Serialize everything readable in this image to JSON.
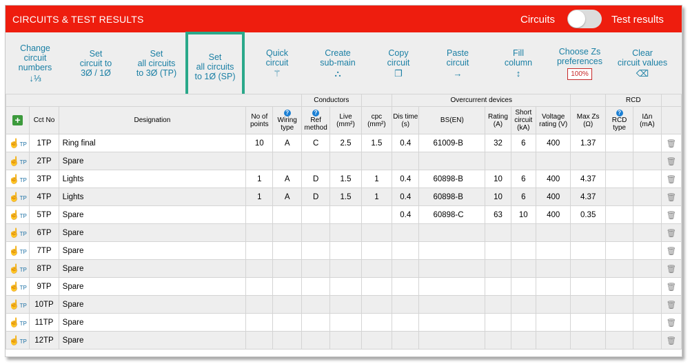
{
  "header": {
    "title": "CIRCUITS & TEST RESULTS",
    "toggle_left_label": "Circuits",
    "toggle_right_label": "Test results",
    "toggle_state": "off",
    "accent_color": "#ee1d0e"
  },
  "toolbar": {
    "change_numbers": {
      "l1": "Change",
      "l2": "circuit",
      "l3": "numbers",
      "icon": "sort-numeric-icon",
      "glyph": "↓⅓"
    },
    "set_circuit_3p1p": {
      "l1": "Set",
      "l2": "circuit to",
      "l3": "3Ø / 1Ø"
    },
    "set_all_3p": {
      "l1": "Set",
      "l2": "all circuits",
      "l3": "to 3Ø (TP)"
    },
    "set_all_1p": {
      "l1": "Set",
      "l2": "all circuits",
      "l3": "to 1Ø (SP)"
    },
    "quick_circuit": {
      "l1": "Quick",
      "l2": "circuit",
      "icon": "magic-wand-icon",
      "glyph": "⚚"
    },
    "create_submain": {
      "l1": "Create",
      "l2": "sub-main",
      "icon": "sitemap-icon",
      "glyph": "⛬"
    },
    "copy_circuit": {
      "l1": "Copy",
      "l2": "circuit",
      "icon": "copy-icon",
      "glyph": "❐"
    },
    "paste_circuit": {
      "l1": "Paste",
      "l2": "circuit",
      "icon": "arrow-right-icon",
      "glyph": "→"
    },
    "fill_column": {
      "l1": "Fill",
      "l2": "column",
      "icon": "vertical-arrows-icon",
      "glyph": "↕"
    },
    "zs_prefs": {
      "l1": "Choose Zs",
      "l2": "preferences",
      "badge": "100%"
    },
    "clear_values": {
      "l1": "Clear",
      "l2": "circuit values",
      "icon": "eraser-icon",
      "glyph": "⌫"
    }
  },
  "table": {
    "groups": {
      "conductors": "Conductors",
      "overcurrent": "Overcurrent devices",
      "rcd": "RCD"
    },
    "headers": {
      "cct_no": "Cct No",
      "designation": "Designation",
      "no_points": "No of points",
      "wiring_type": "Wiring type",
      "ref_method": "Ref method",
      "live": "Live (mm²)",
      "cpc": "cpc (mm²)",
      "dis_time": "Dis time (s)",
      "bs_en": "BS(EN)",
      "rating": "Rating (A)",
      "short_circuit": "Short circuit (kA)",
      "voltage": "Voltage rating (V)",
      "max_zs": "Max Zs (Ω)",
      "rcd_type": "RCD type",
      "idn": "IΔn (mA)",
      "help_glyph": "?"
    },
    "hand_glyph": "☝",
    "tp_label": "TP",
    "add_glyph": "+",
    "trash_glyph": "🗑",
    "rows": [
      {
        "cct": "1TP",
        "des": "Ring final",
        "pts": "10",
        "wt": "A",
        "ref": "C",
        "live": "2.5",
        "cpc": "1.5",
        "dis": "0.4",
        "bs": "61009-B",
        "rating": "32",
        "sc": "6",
        "volt": "400",
        "zs": "1.37",
        "rcd": "",
        "idn": ""
      },
      {
        "cct": "2TP",
        "des": "Spare",
        "pts": "",
        "wt": "",
        "ref": "",
        "live": "",
        "cpc": "",
        "dis": "",
        "bs": "",
        "rating": "",
        "sc": "",
        "volt": "",
        "zs": "",
        "rcd": "",
        "idn": ""
      },
      {
        "cct": "3TP",
        "des": "Lights",
        "pts": "1",
        "wt": "A",
        "ref": "D",
        "live": "1.5",
        "cpc": "1",
        "dis": "0.4",
        "bs": "60898-B",
        "rating": "10",
        "sc": "6",
        "volt": "400",
        "zs": "4.37",
        "rcd": "",
        "idn": ""
      },
      {
        "cct": "4TP",
        "des": "Lights",
        "pts": "1",
        "wt": "A",
        "ref": "D",
        "live": "1.5",
        "cpc": "1",
        "dis": "0.4",
        "bs": "60898-B",
        "rating": "10",
        "sc": "6",
        "volt": "400",
        "zs": "4.37",
        "rcd": "",
        "idn": ""
      },
      {
        "cct": "5TP",
        "des": "Spare",
        "pts": "",
        "wt": "",
        "ref": "",
        "live": "",
        "cpc": "",
        "dis": "0.4",
        "bs": "60898-C",
        "rating": "63",
        "sc": "10",
        "volt": "400",
        "zs": "0.35",
        "rcd": "",
        "idn": ""
      },
      {
        "cct": "6TP",
        "des": "Spare",
        "pts": "",
        "wt": "",
        "ref": "",
        "live": "",
        "cpc": "",
        "dis": "",
        "bs": "",
        "rating": "",
        "sc": "",
        "volt": "",
        "zs": "",
        "rcd": "",
        "idn": ""
      },
      {
        "cct": "7TP",
        "des": "Spare",
        "pts": "",
        "wt": "",
        "ref": "",
        "live": "",
        "cpc": "",
        "dis": "",
        "bs": "",
        "rating": "",
        "sc": "",
        "volt": "",
        "zs": "",
        "rcd": "",
        "idn": ""
      },
      {
        "cct": "8TP",
        "des": "Spare",
        "pts": "",
        "wt": "",
        "ref": "",
        "live": "",
        "cpc": "",
        "dis": "",
        "bs": "",
        "rating": "",
        "sc": "",
        "volt": "",
        "zs": "",
        "rcd": "",
        "idn": ""
      },
      {
        "cct": "9TP",
        "des": "Spare",
        "pts": "",
        "wt": "",
        "ref": "",
        "live": "",
        "cpc": "",
        "dis": "",
        "bs": "",
        "rating": "",
        "sc": "",
        "volt": "",
        "zs": "",
        "rcd": "",
        "idn": ""
      },
      {
        "cct": "10TP",
        "des": "Spare",
        "pts": "",
        "wt": "",
        "ref": "",
        "live": "",
        "cpc": "",
        "dis": "",
        "bs": "",
        "rating": "",
        "sc": "",
        "volt": "",
        "zs": "",
        "rcd": "",
        "idn": ""
      },
      {
        "cct": "11TP",
        "des": "Spare",
        "pts": "",
        "wt": "",
        "ref": "",
        "live": "",
        "cpc": "",
        "dis": "",
        "bs": "",
        "rating": "",
        "sc": "",
        "volt": "",
        "zs": "",
        "rcd": "",
        "idn": ""
      },
      {
        "cct": "12TP",
        "des": "Spare",
        "pts": "",
        "wt": "",
        "ref": "",
        "live": "",
        "cpc": "",
        "dis": "",
        "bs": "",
        "rating": "",
        "sc": "",
        "volt": "",
        "zs": "",
        "rcd": "",
        "idn": ""
      }
    ]
  }
}
